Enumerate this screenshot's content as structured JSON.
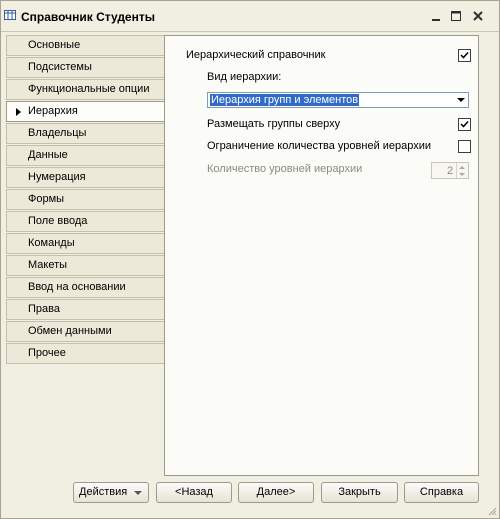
{
  "window": {
    "title": "Справочник Студенты"
  },
  "sidebar": {
    "items": [
      {
        "label": "Основные"
      },
      {
        "label": "Подсистемы"
      },
      {
        "label": "Функциональные опции"
      },
      {
        "label": "Иерархия",
        "active": true
      },
      {
        "label": "Владельцы"
      },
      {
        "label": "Данные"
      },
      {
        "label": "Нумерация"
      },
      {
        "label": "Формы"
      },
      {
        "label": "Поле ввода"
      },
      {
        "label": "Команды"
      },
      {
        "label": "Макеты"
      },
      {
        "label": "Ввод на основании"
      },
      {
        "label": "Права"
      },
      {
        "label": "Обмен данными"
      },
      {
        "label": "Прочее"
      }
    ]
  },
  "hierarchy": {
    "hierarchical_label": "Иерархический справочник",
    "hierarchical_checked": true,
    "type_label": "Вид иерархии:",
    "type_value": "Иерархия групп и элементов",
    "groups_on_top_label": "Размещать группы сверху",
    "groups_on_top_checked": true,
    "limit_levels_label": "Ограничение количества уровней иерархии",
    "limit_levels_checked": false,
    "levels_count_label": "Количество уровней иерархии",
    "levels_count_value": "2"
  },
  "footer": {
    "actions_label": "Действия",
    "back_label": "<Назад",
    "next_label": "Далее>",
    "close_label": "Закрыть",
    "help_label": "Справка"
  },
  "colors": {
    "selection": "#316ac5",
    "background": "#f1efe2",
    "disabled_text": "#8c8a7f"
  }
}
